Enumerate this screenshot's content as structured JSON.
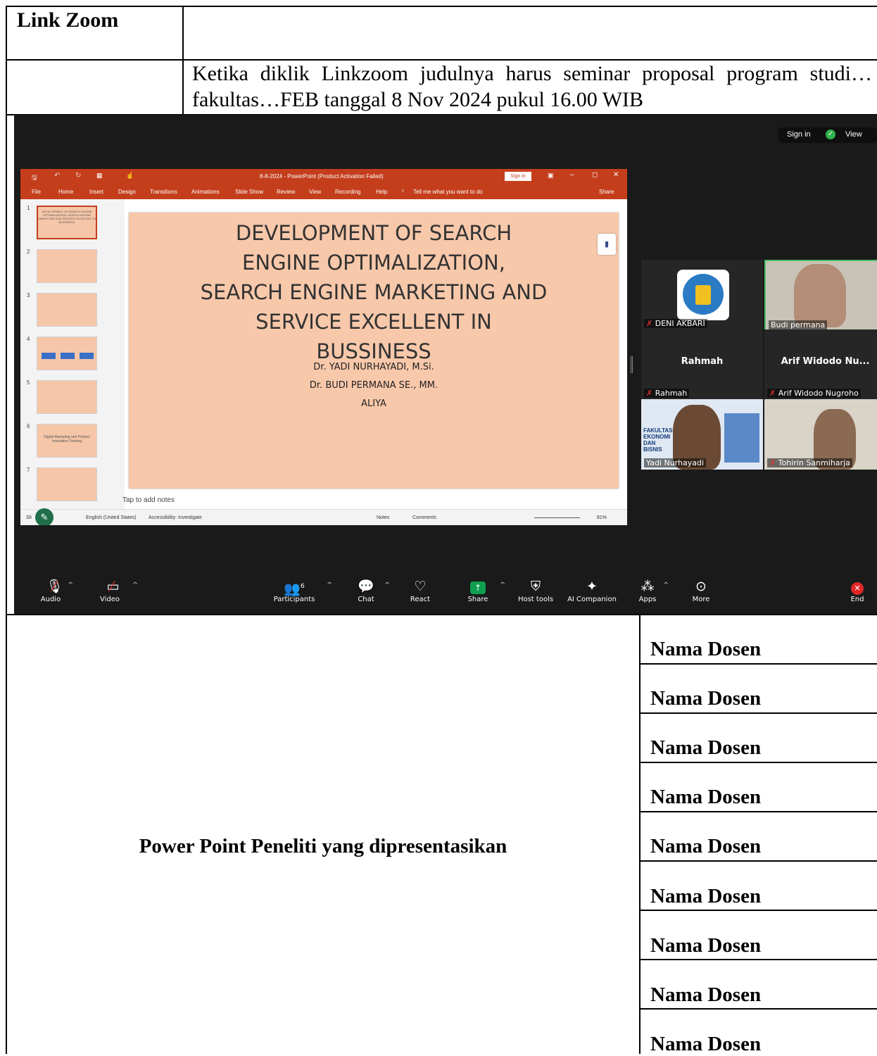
{
  "header": {
    "link_label": "Link Zoom",
    "instruction": "Ketika diklik Linkzoom judulnya harus seminar proposal program studi…fakultas…FEB tanggal 8 Nov 2024 pukul 16.00 WIB"
  },
  "zoom": {
    "top_right": {
      "sign_in": "Sign in",
      "view": "View"
    },
    "ppt": {
      "window_title": "8-8-2024 - PowerPoint (Product Activation Failed)",
      "sign_in_label": "Sign in",
      "menu": [
        "File",
        "Home",
        "Insert",
        "Design",
        "Transitions",
        "Animations",
        "Slide Show",
        "Review",
        "View",
        "Recording",
        "Help"
      ],
      "tell_me": "Tell me what you want to do",
      "share": "Share",
      "thumbnail_numbers": [
        "1",
        "2",
        "3",
        "4",
        "5",
        "6",
        "7"
      ],
      "thumb6_text": "Digital Marketing and Product Innovation Training",
      "slide_title": "DEVELOPMENT OF SEARCH ENGINE OPTIMALIZATION, SEARCH ENGINE MARKETING AND SERVICE EXCELLENT IN BUSSINESS",
      "authors": [
        "Dr. YADI NURHAYADI, M.Si.",
        "Dr. BUDI PERMANA SE., MM.",
        "ALIYA"
      ],
      "notes_placeholder": "Tap to add notes",
      "status": {
        "slide": "Sli",
        "language": "English (United States)",
        "accessibility": "Accessibility: Investigate",
        "notes": "Notes",
        "comments": "Comments",
        "zoom": "81%"
      }
    },
    "participants": [
      {
        "name": "DENI AKBARI",
        "muted": true
      },
      {
        "name": "Budi permana",
        "muted": false
      },
      {
        "name": "Rahmah",
        "display": "Rahmah",
        "muted": true
      },
      {
        "name": "Arif Widodo Nugroho",
        "display": "Arif Widodo Nu...",
        "muted": true
      },
      {
        "name": "Yadi Nurhayadi",
        "muted": false,
        "bg_text": "FAKULTAS EKONOMI DAN BISNIS"
      },
      {
        "name": "Tohirin Sanmiharja",
        "muted": true
      }
    ],
    "toolbar": {
      "audio": "Audio",
      "video": "Video",
      "participants": "Participants",
      "participants_count": "6",
      "chat": "Chat",
      "react": "React",
      "share": "Share",
      "host_tools": "Host tools",
      "ai_companion": "AI Companion",
      "apps": "Apps",
      "more": "More",
      "end": "End"
    }
  },
  "bottom": {
    "caption": "Power Point Peneliti yang dipresentasikan",
    "dosen": [
      "Nama Dosen",
      "Nama Dosen",
      "Nama Dosen",
      "Nama Dosen",
      "Nama Dosen",
      "Nama Dosen",
      "Nama Dosen",
      "Nama Dosen",
      "Nama Dosen"
    ]
  },
  "colors": {
    "ppt_accent": "#c43e1c",
    "slide_bg": "#f8c8aa",
    "zoom_bg": "#1a1a1a",
    "share_green": "#0e9f4f",
    "end_red": "#e02828",
    "active_speaker": "#4ec06a"
  }
}
